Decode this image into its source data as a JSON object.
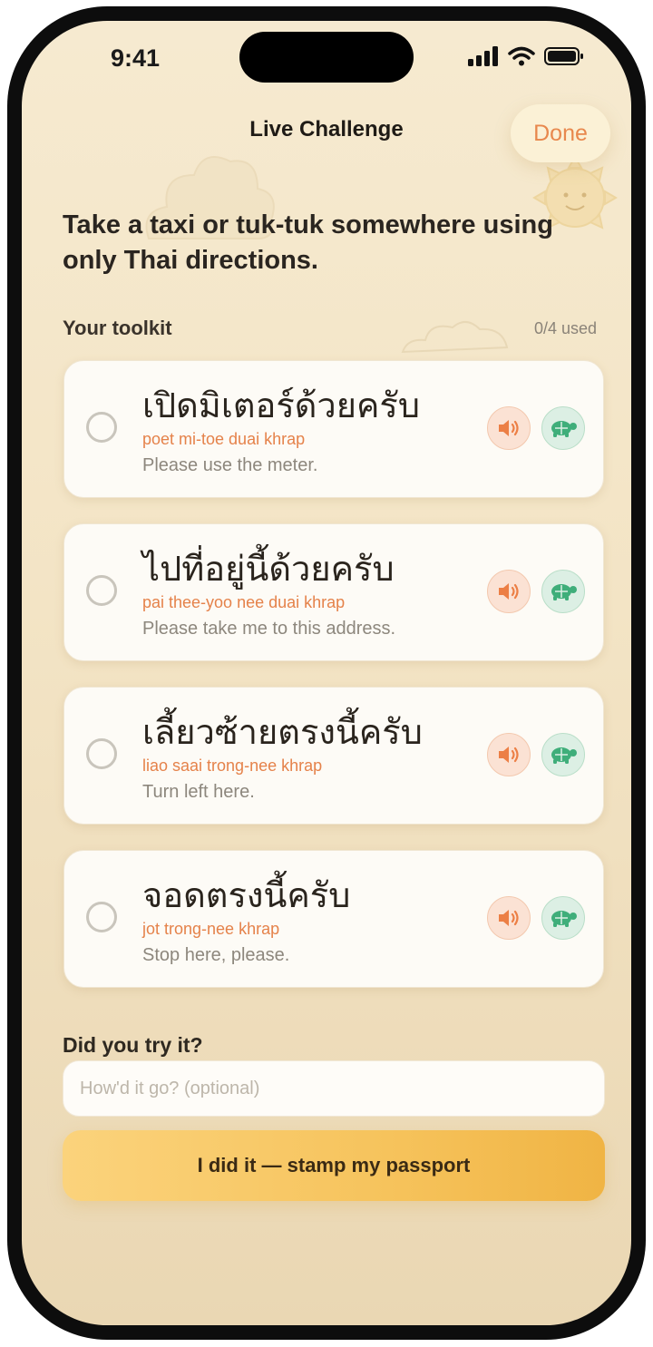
{
  "status_bar": {
    "time": "9:41"
  },
  "nav": {
    "title": "Live Challenge",
    "done_label": "Done"
  },
  "challenge": {
    "prompt": "Take a taxi or tuk-tuk somewhere using only Thai directions."
  },
  "toolkit": {
    "label": "Your toolkit",
    "used_count": "0/4 used",
    "phrases": [
      {
        "thai": "เปิดมิเตอร์ด้วยครับ",
        "romanization": "poet mi-toe duai khrap",
        "english": "Please use the meter."
      },
      {
        "thai": "ไปที่อยู่นี้ด้วยครับ",
        "romanization": "pai thee-yoo nee duai khrap",
        "english": "Please take me to this address."
      },
      {
        "thai": "เลี้ยวซ้ายตรงนี้ครับ",
        "romanization": "liao saai trong-nee khrap",
        "english": "Turn left here."
      },
      {
        "thai": "จอดตรงนี้ครับ",
        "romanization": "jot trong-nee khrap",
        "english": "Stop here, please."
      }
    ],
    "icons": {
      "play": "speaker-icon",
      "slow_play": "turtle-icon"
    }
  },
  "feedback": {
    "label": "Did you try it?",
    "placeholder": "How'd it go? (optional)",
    "value": ""
  },
  "submit": {
    "label": "I did it — stamp my passport"
  },
  "colors": {
    "accent": "#e8884d",
    "button": "#f6c35c",
    "background": "#f6ead0"
  }
}
